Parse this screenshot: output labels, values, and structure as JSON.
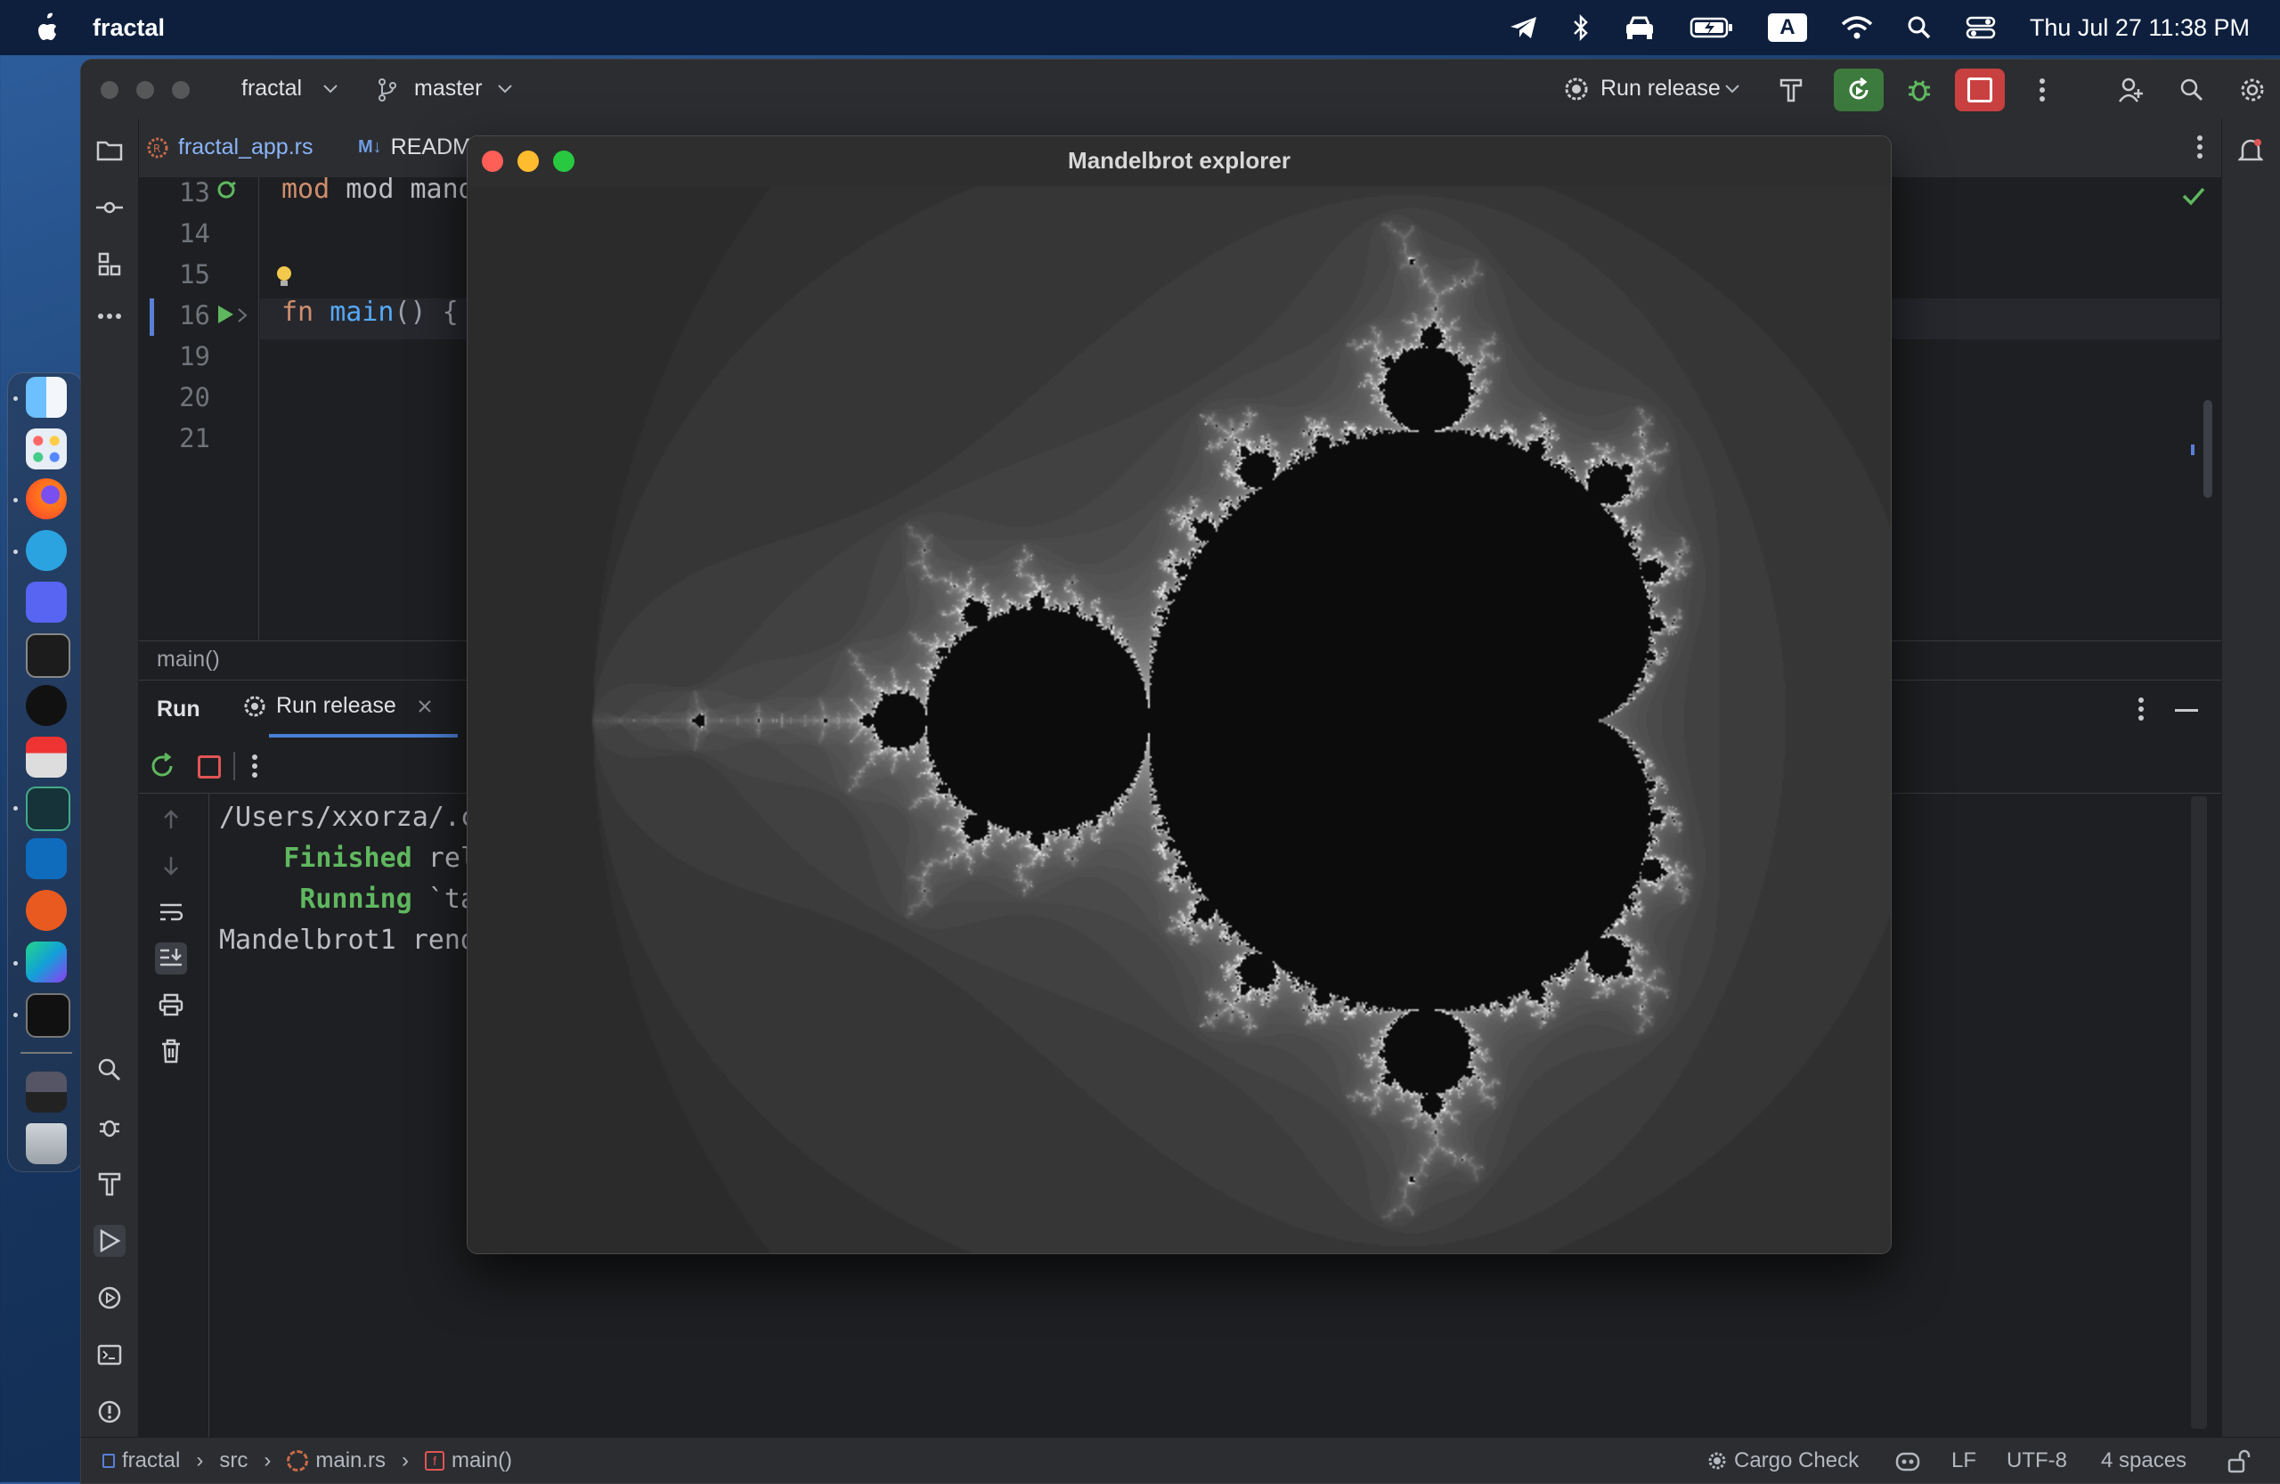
{
  "menubar": {
    "app_name": "fractal",
    "clock": "Thu Jul 27  11:38 PM",
    "input_source": "A"
  },
  "ide": {
    "project": "fractal",
    "branch": "master",
    "run_config": "Run release",
    "tabs": [
      {
        "label": "fractal_app.rs",
        "badge": ""
      },
      {
        "label": "READM",
        "badge": "M↓"
      }
    ],
    "editor": {
      "line_numbers": [
        "13",
        "14",
        "15",
        "16",
        "19",
        "20",
        "21"
      ],
      "line13": "mod mandelbro",
      "line16_kw": "fn",
      "line16_name": "main",
      "line16_rest": "() { r",
      "breadcrumb": "main()"
    },
    "run_panel": {
      "title": "Run",
      "tab": "Run release",
      "console": [
        {
          "text": "/Users/xxorza/.c",
          "indent": "",
          "style": "plain"
        },
        {
          "text": "Finished",
          "rest": " rel",
          "indent": "    ",
          "style": "green"
        },
        {
          "text": "Running",
          "rest": " `ta",
          "indent": "     ",
          "style": "green"
        },
        {
          "text": "Mandelbrot1 rend",
          "indent": "",
          "style": "plain"
        }
      ]
    },
    "statusbar": {
      "path": [
        "fractal",
        "src",
        "main.rs",
        "main()"
      ],
      "cargo": "Cargo Check",
      "line_sep": "LF",
      "encoding": "UTF-8",
      "indent": "4 spaces"
    }
  },
  "mandelbrot": {
    "title": "Mandelbrot explorer"
  },
  "colors": {
    "ide_bg": "#1e1f22",
    "ide_panel": "#2b2d30",
    "accent_green": "#5fb85f",
    "stop_red": "#e05555",
    "keyword": "#cf8e6d",
    "function": "#56a8f5"
  }
}
